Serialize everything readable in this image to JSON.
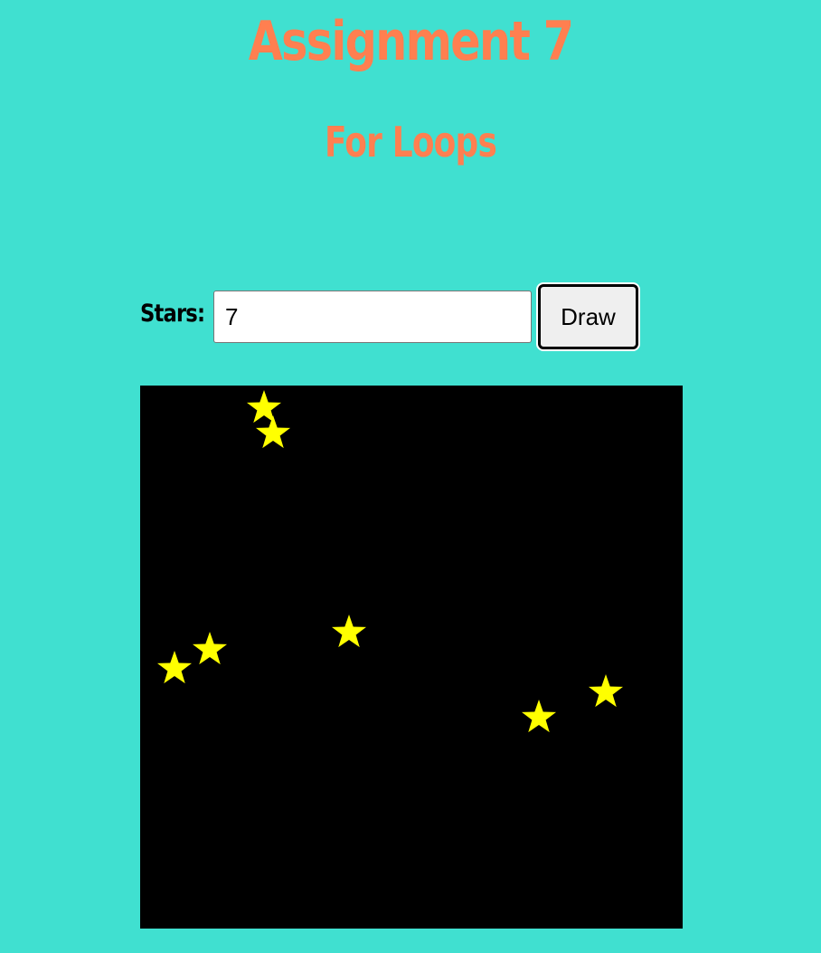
{
  "page": {
    "title": "Assignment 7",
    "subtitle": "For Loops"
  },
  "controls": {
    "stars_label": "Stars:",
    "stars_value": "7",
    "draw_label": "Draw"
  },
  "colors": {
    "background": "#40e0d0",
    "title": "#ff7f50",
    "canvas_background": "#000000",
    "star_fill": "#ffff00"
  },
  "icons": {
    "star": "star-icon"
  }
}
